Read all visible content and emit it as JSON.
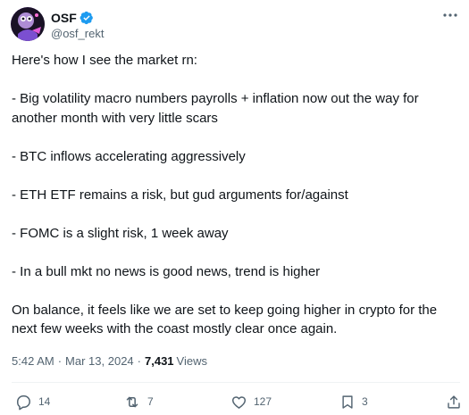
{
  "author": {
    "display_name": "OSF",
    "handle": "@osf_rekt",
    "avatar_icon": "avatar-image",
    "verified_icon": "verified-badge-icon",
    "verified_color": "#1d9bf0"
  },
  "tweet": {
    "paragraphs": [
      "Here's how I see the market rn:",
      "- Big volatility macro numbers payrolls + inflation now out the way for another month with very little scars",
      "- BTC inflows accelerating aggressively",
      "- ETH ETF remains a risk, but gud arguments for/against",
      "- FOMC is a slight risk, 1 week away",
      "- In a bull mkt no news is good news, trend is higher",
      "On balance, it feels like we are set to keep going higher in crypto for the next few weeks with the coast mostly clear once again."
    ]
  },
  "meta": {
    "time": "5:42 AM",
    "date": "Mar 13, 2024",
    "views_count": "7,431",
    "views_label": "Views"
  },
  "actions": {
    "replies": "14",
    "reposts": "7",
    "likes": "127",
    "bookmarks": "3"
  },
  "colors": {
    "text_primary": "#0f1419",
    "text_secondary": "#536471",
    "divider": "#eff3f4"
  }
}
